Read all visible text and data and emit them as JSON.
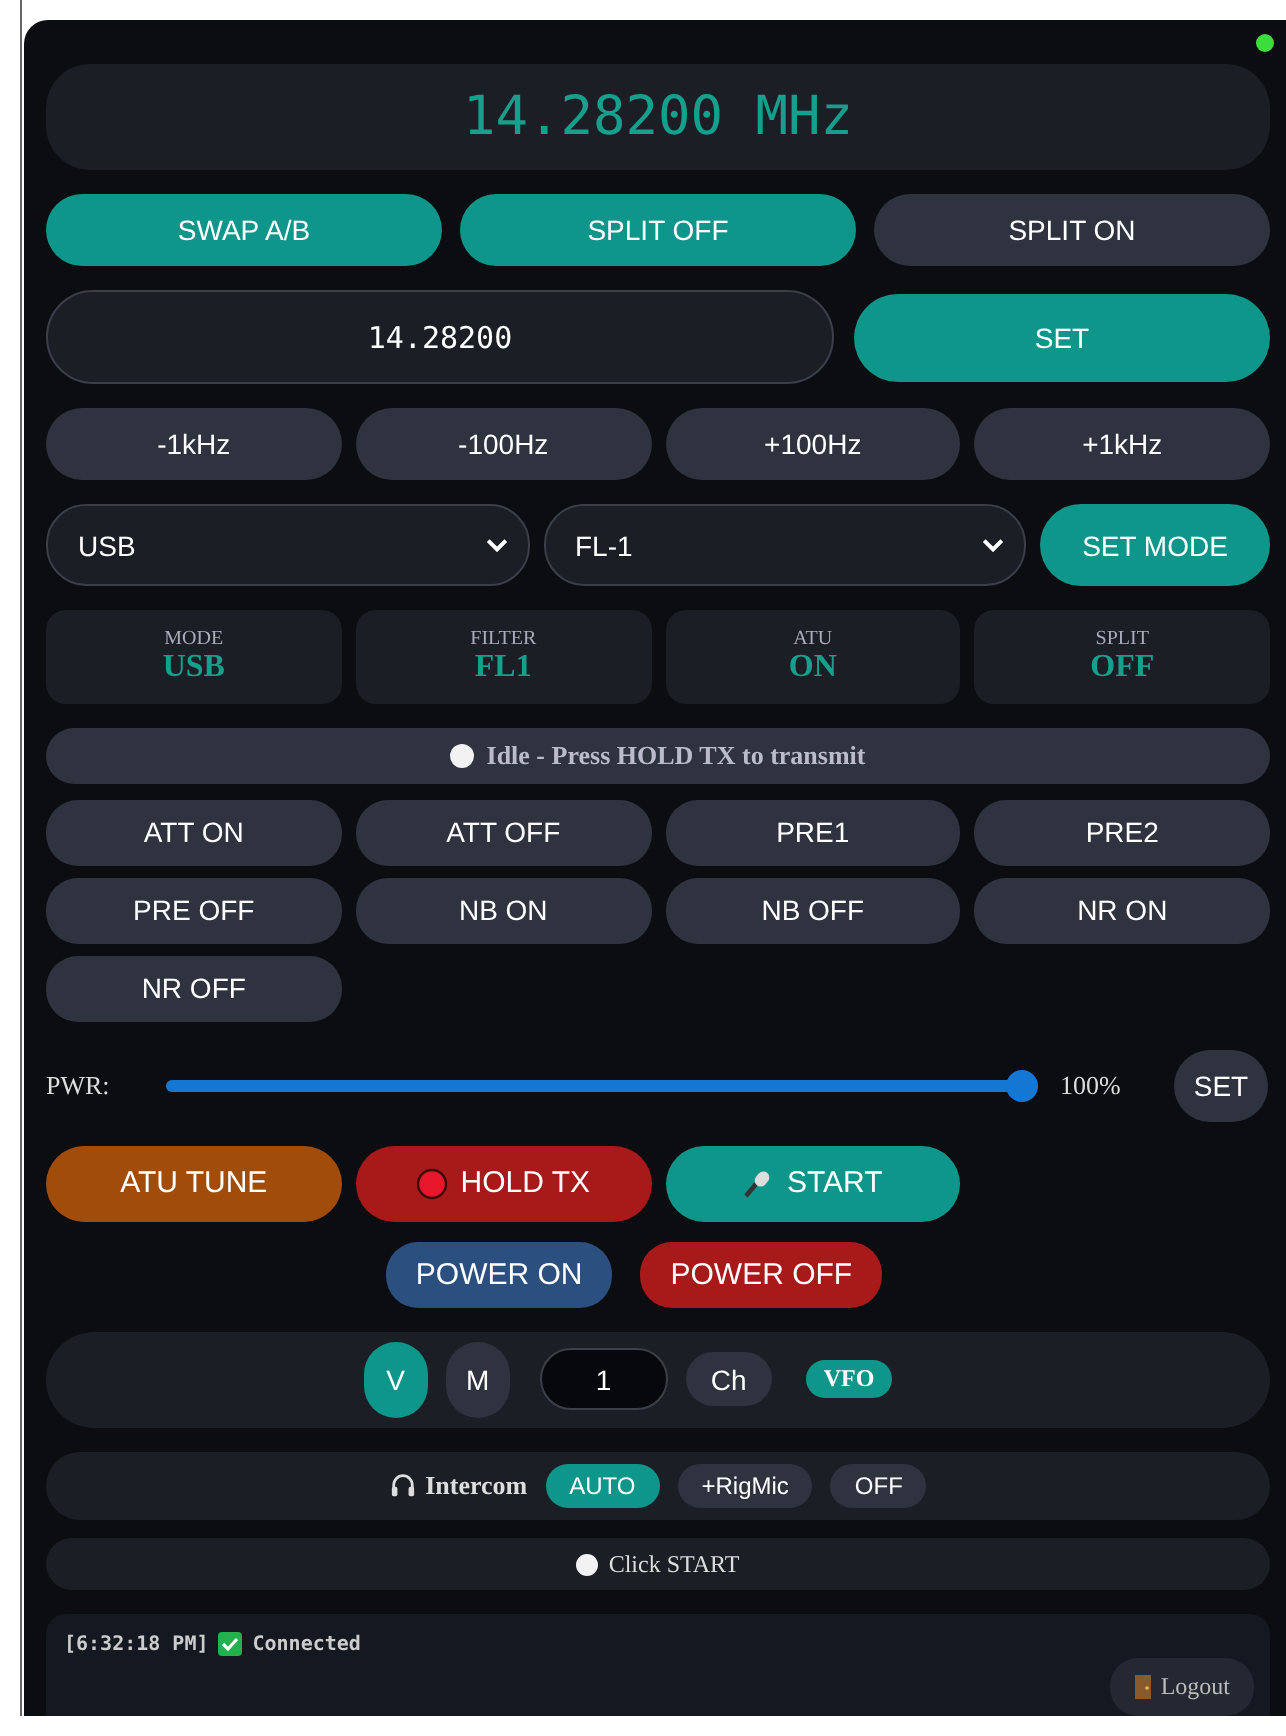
{
  "status_led": {
    "on": true
  },
  "frequency_display": "14.28200 MHz",
  "vfo_buttons": [
    {
      "label": "SWAP A/B",
      "active": true
    },
    {
      "label": "SPLIT OFF",
      "active": true
    },
    {
      "label": "SPLIT ON",
      "active": false
    }
  ],
  "frequency_input": {
    "value": "14.28200",
    "button": "SET"
  },
  "step_buttons": [
    "-1kHz",
    "-100Hz",
    "+100Hz",
    "+1kHz"
  ],
  "mode_select": {
    "value": "USB"
  },
  "filter_select": {
    "value": "FL-1"
  },
  "set_mode_button": "SET MODE",
  "status_cards": [
    {
      "label": "MODE",
      "value": "USB"
    },
    {
      "label": "FILTER",
      "value": "FL1"
    },
    {
      "label": "ATU",
      "value": "ON"
    },
    {
      "label": "SPLIT",
      "value": "OFF"
    }
  ],
  "tx_status": {
    "text": "Idle - Press HOLD TX to transmit",
    "transmitting": false
  },
  "function_buttons": [
    "ATT ON",
    "ATT OFF",
    "PRE1",
    "PRE2",
    "PRE OFF",
    "NB ON",
    "NB OFF",
    "NR ON",
    "NR OFF"
  ],
  "power": {
    "label": "PWR:",
    "level": 1,
    "reading": "100%",
    "button": "SET"
  },
  "actions": [
    {
      "label": "ATU TUNE",
      "kind": "tune"
    },
    {
      "label": "HOLD TX",
      "kind": "ptt"
    },
    {
      "label": "START",
      "kind": "mic"
    }
  ],
  "power_buttons": [
    {
      "label": "POWER ON",
      "kind": "on"
    },
    {
      "label": "POWER OFF",
      "kind": "off"
    }
  ],
  "memory_bar": {
    "modes": [
      {
        "label": "V",
        "selected": true
      },
      {
        "label": "M",
        "selected": false
      }
    ],
    "channel": "1",
    "channel_button": "Ch",
    "badge": "VFO"
  },
  "intercom": {
    "label": "Intercom",
    "options": [
      {
        "label": "AUTO",
        "selected": true
      },
      {
        "label": "+RigMic",
        "selected": false
      },
      {
        "label": "OFF",
        "selected": false
      }
    ]
  },
  "audio_status": {
    "text": "Click START",
    "active": false
  },
  "log": [
    {
      "time": "[6:32:18 PM]",
      "ok": true,
      "message": "Connected"
    }
  ],
  "logout_button": "Logout"
}
